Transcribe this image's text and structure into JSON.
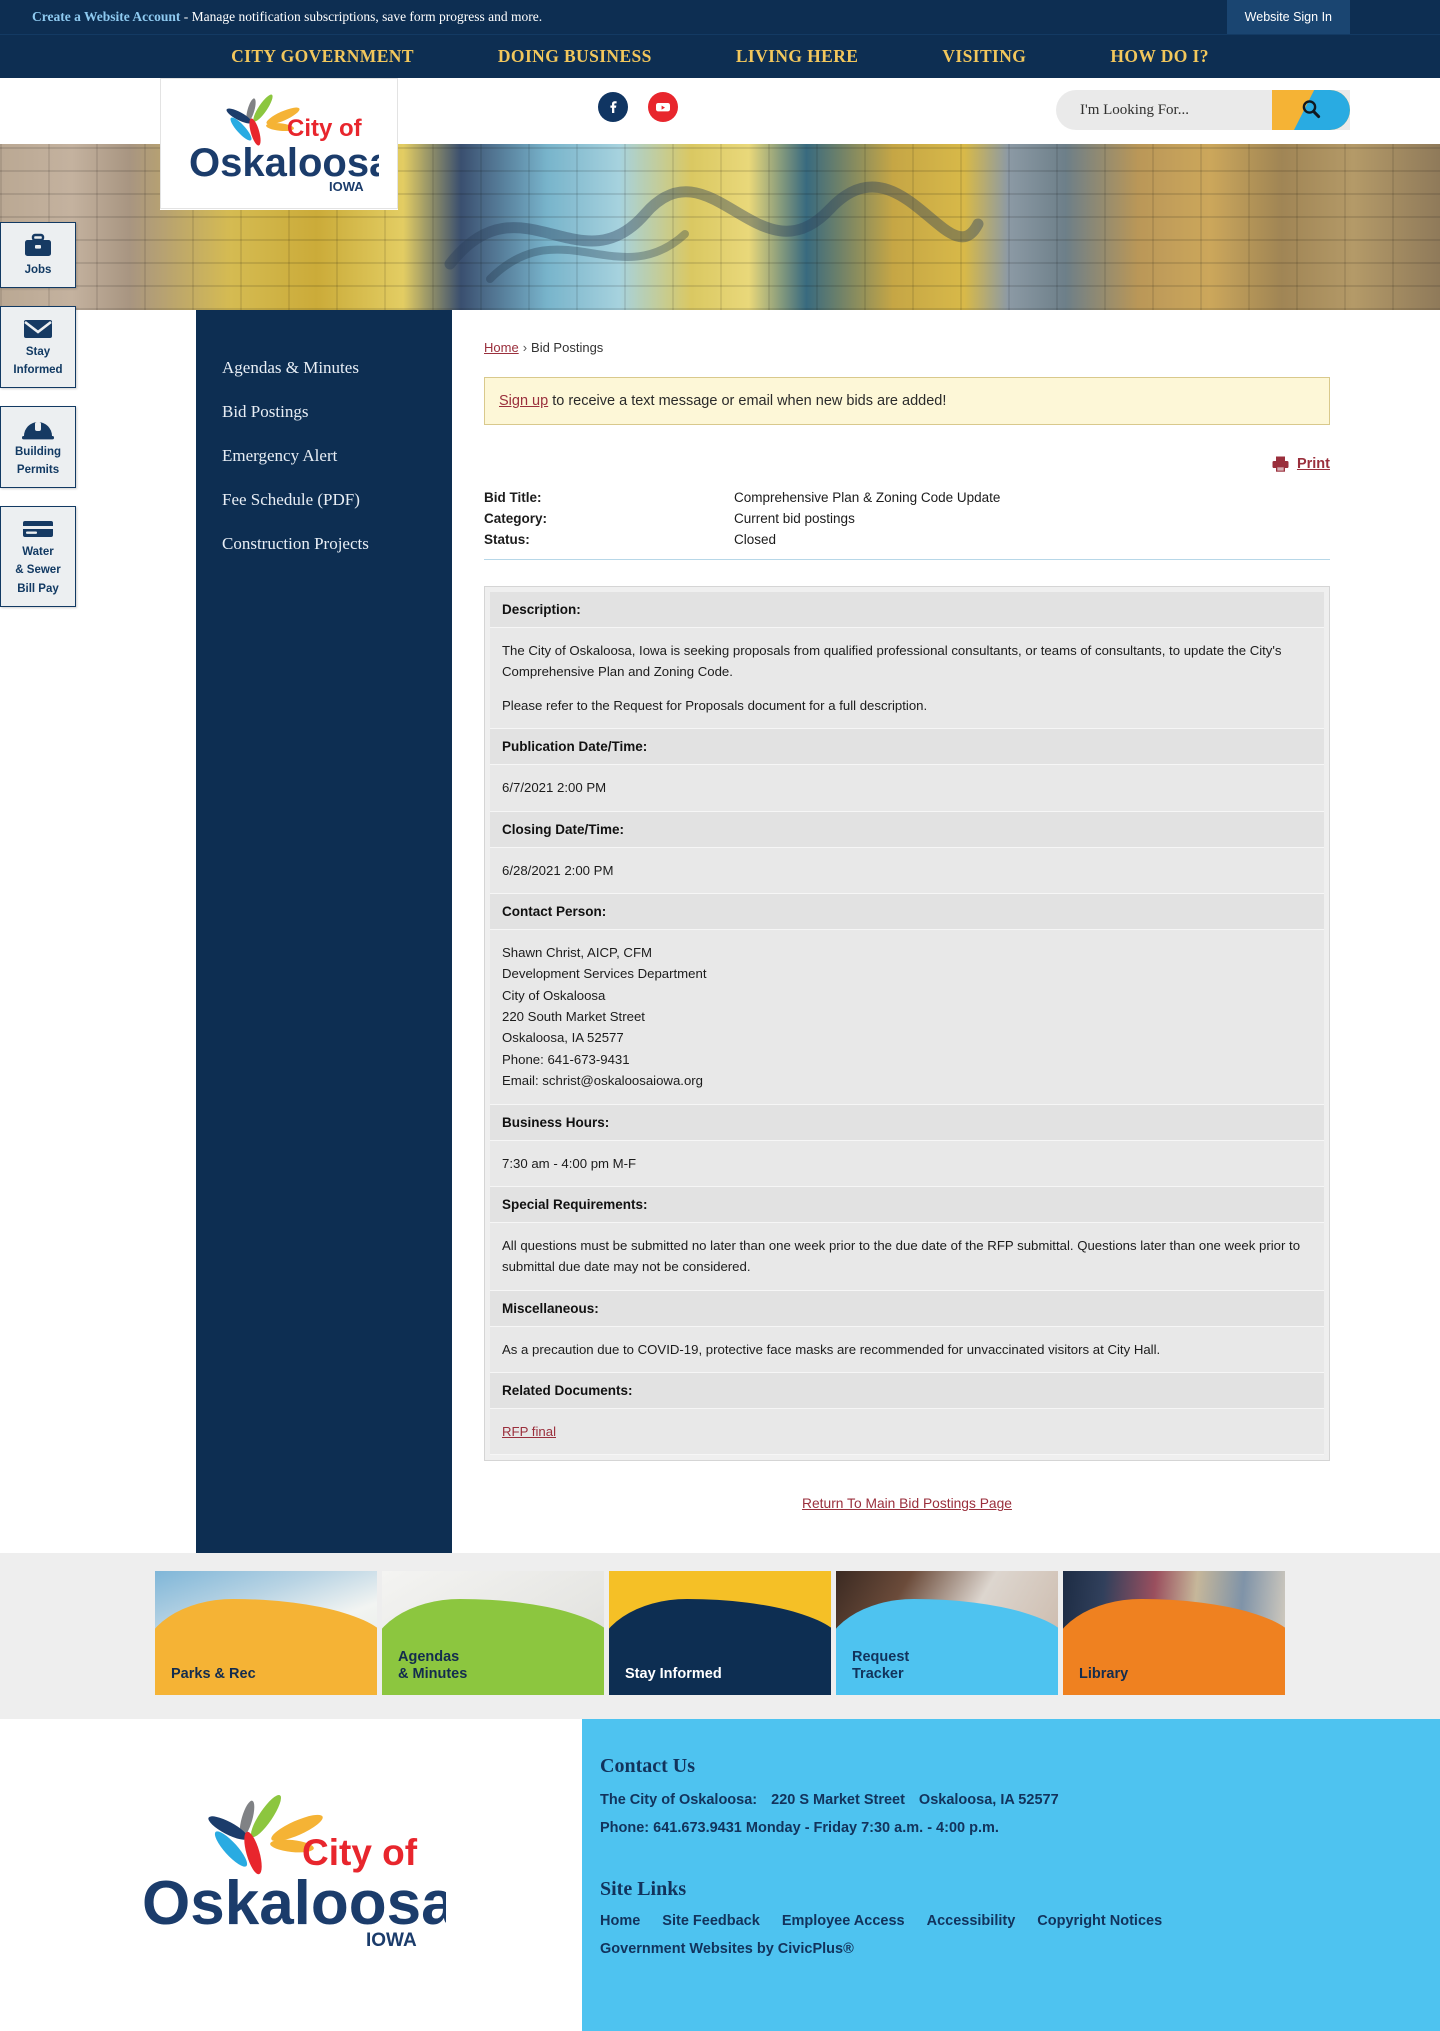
{
  "utility": {
    "create_account_label": "Create a Website Account",
    "tagline": " - Manage notification subscriptions, save form progress and more.",
    "signin_label": "Website Sign In"
  },
  "nav": {
    "items": [
      {
        "label": "CITY GOVERNMENT"
      },
      {
        "label": "DOING BUSINESS"
      },
      {
        "label": "LIVING HERE"
      },
      {
        "label": "VISITING"
      },
      {
        "label": "HOW DO I?"
      }
    ]
  },
  "brand": {
    "logo_city_of": "City of",
    "logo_name": "Oskaloosa",
    "logo_state": "IOWA",
    "social": [
      {
        "name": "facebook-icon",
        "glyph": "f"
      },
      {
        "name": "youtube-icon",
        "glyph": "▶"
      }
    ]
  },
  "search": {
    "placeholder": "I'm Looking For...",
    "value": "",
    "button_name": "search-submit-button"
  },
  "rail": {
    "items": [
      {
        "label": "Jobs",
        "icon": "briefcase-icon"
      },
      {
        "label": "Stay\nInformed",
        "line1": "Stay",
        "line2": "Informed",
        "icon": "envelope-icon"
      },
      {
        "label": "Building Permits",
        "line1": "Building",
        "line2": "Permits",
        "icon": "hardhat-icon"
      },
      {
        "label": "Water & Sewer Bill Pay",
        "line1": "Water",
        "line2": "& Sewer",
        "line3": "Bill Pay",
        "icon": "credit-card-icon"
      }
    ]
  },
  "left_nav": {
    "items": [
      {
        "label": "Agendas & Minutes"
      },
      {
        "label": "Bid Postings"
      },
      {
        "label": "Emergency Alert"
      },
      {
        "label": "Fee Schedule (PDF)"
      },
      {
        "label": "Construction Projects"
      }
    ]
  },
  "breadcrumb": {
    "home": "Home",
    "separator": "›",
    "current": "Bid Postings"
  },
  "signup_notice": {
    "link": "Sign up",
    "text": " to receive a text message or email when new bids are added!"
  },
  "print": {
    "label": "Print"
  },
  "bid_summary": {
    "rows": [
      {
        "key": "Bid Title:",
        "value": "Comprehensive Plan & Zoning Code Update"
      },
      {
        "key": "Category:",
        "value": "Current bid postings"
      },
      {
        "key": "Status:",
        "value": "Closed"
      }
    ]
  },
  "bid_detail": {
    "description_heading": "Description:",
    "description_p1": "The City of Oskaloosa, Iowa is seeking proposals from qualified professional consultants, or teams of consultants, to update the City's Comprehensive Plan and Zoning Code.",
    "description_p2": "Please refer to the Request for Proposals document for a full description.",
    "publication_heading": "Publication Date/Time:",
    "publication_value": "6/7/2021 2:00 PM",
    "closing_heading": "Closing Date/Time:",
    "closing_value": "6/28/2021 2:00 PM",
    "contact_heading": "Contact Person:",
    "contact_lines": [
      "Shawn Christ, AICP, CFM",
      "Development Services Department",
      "City of Oskaloosa",
      "220 South Market Street",
      "Oskaloosa, IA 52577",
      "Phone: 641-673-9431",
      "Email: schrist@oskaloosaiowa.org"
    ],
    "hours_heading": "Business Hours:",
    "hours_value": "7:30 am - 4:00 pm M-F",
    "special_heading": "Special Requirements:",
    "special_value": "All questions must be submitted no later than one week prior to the due date of the RFP submittal. Questions later than one week prior to submittal due date may not be considered.",
    "misc_heading": "Miscellaneous:",
    "misc_value": "As a precaution due to COVID-19, protective face masks are recommended for unvaccinated visitors at City Hall.",
    "related_heading": "Related Documents:",
    "related_link": "RFP final"
  },
  "return_link": {
    "label": "Return To Main Bid Postings Page"
  },
  "promos": [
    {
      "label": "Parks & Rec",
      "line1": "Parks & Rec",
      "line2": "",
      "wave": "#f5b335",
      "text_color": "#132c4e"
    },
    {
      "label": "Agendas & Minutes",
      "line1": "Agendas",
      "line2": "& Minutes",
      "wave": "#8cc63f",
      "text_color": "#132c4e"
    },
    {
      "label": "Stay Informed",
      "line1": "Stay Informed",
      "line2": "",
      "wave": "#0d2e52",
      "text_color": "#ffffff"
    },
    {
      "label": "Request Tracker",
      "line1": "Request",
      "line2": "Tracker",
      "wave": "#4ec3f0",
      "text_color": "#12335c"
    },
    {
      "label": "Library",
      "line1": "Library",
      "line2": "",
      "wave": "#ef8120",
      "text_color": "#132c4e"
    }
  ],
  "footer": {
    "contact_title": "Contact Us",
    "address_line_a": "The City of Oskaloosa:",
    "address_line_b": "220 S Market Street",
    "address_line_c": "Oskaloosa, IA 52577",
    "phone_line": "Phone: 641.673.9431  Monday - Friday 7:30 a.m. - 4:00 p.m.",
    "site_links_title": "Site Links",
    "links": [
      {
        "label": "Home"
      },
      {
        "label": "Site Feedback"
      },
      {
        "label": "Employee Access"
      },
      {
        "label": "Accessibility"
      },
      {
        "label": "Copyright Notices"
      }
    ],
    "credit": "Government Websites by CivicPlus®"
  },
  "colors": {
    "navy": "#0d2e52",
    "gold": "#f2c75c",
    "accent_red": "#9a2f3c",
    "cyan": "#4ec3f0",
    "orange": "#ef8120",
    "green": "#8cc63f"
  }
}
